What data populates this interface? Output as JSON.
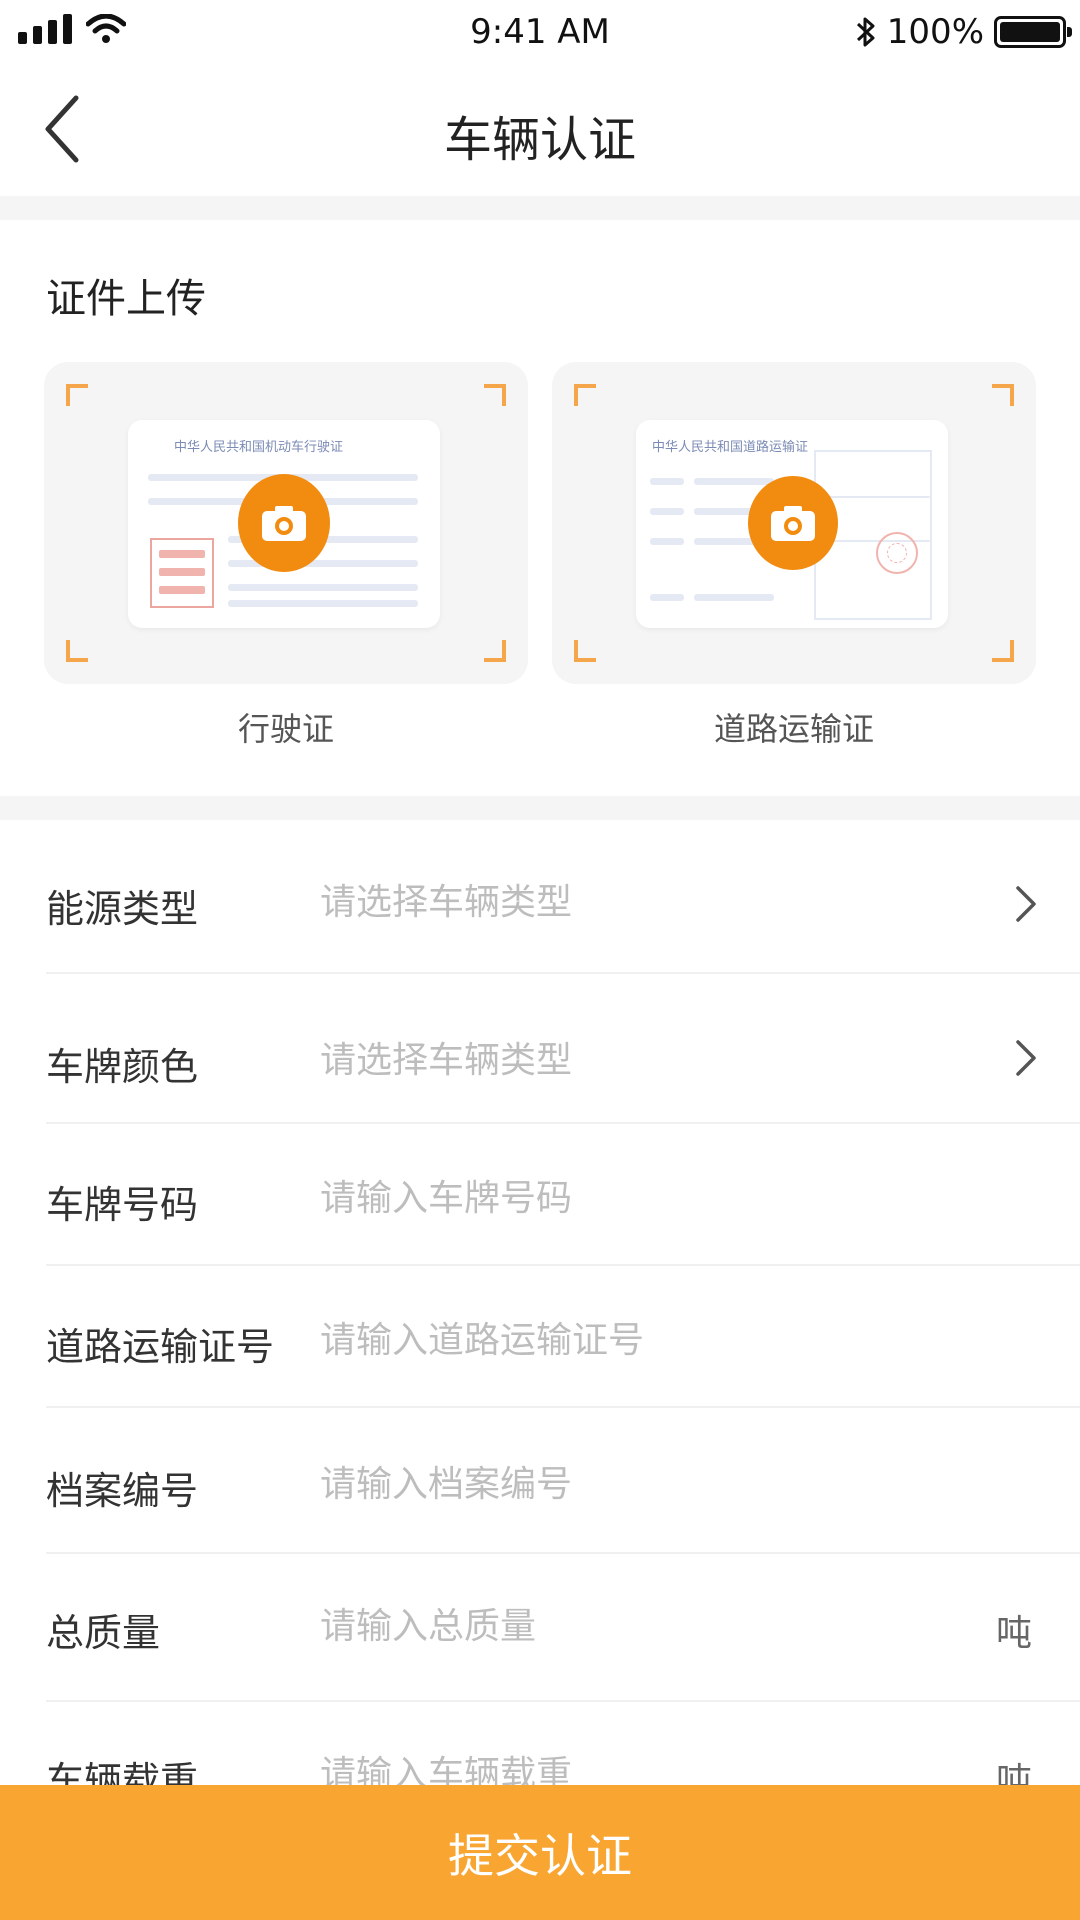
{
  "status_bar": {
    "time": "9:41 AM",
    "battery": "100%"
  },
  "nav": {
    "title": "车辆认证"
  },
  "upload": {
    "section_title": "证件上传",
    "cards": [
      {
        "label": "行驶证",
        "doc_title": "中华人民共和国机动车行驶证"
      },
      {
        "label": "道路运输证",
        "doc_title": "中华人民共和国道路运输证"
      }
    ]
  },
  "form": {
    "rows": [
      {
        "label": "能源类型",
        "placeholder": "请选择车辆类型"
      },
      {
        "label": "车牌颜色",
        "placeholder": "请选择车辆类型"
      },
      {
        "label": "车牌号码",
        "placeholder": "请输入车牌号码"
      },
      {
        "label": "道路运输证号",
        "placeholder": "请输入道路运输证号"
      },
      {
        "label": "档案编号",
        "placeholder": "请输入档案编号"
      },
      {
        "label": "总质量",
        "placeholder": "请输入总质量",
        "unit": "吨"
      },
      {
        "label": "车辆载重",
        "placeholder": "请输入车辆载重",
        "unit": "吨"
      }
    ]
  },
  "submit": {
    "label": "提交认证"
  },
  "colors": {
    "accent": "#f9a532",
    "camera": "#f28c10",
    "placeholder": "#bdbdbd",
    "divider": "#f0f0f0"
  }
}
